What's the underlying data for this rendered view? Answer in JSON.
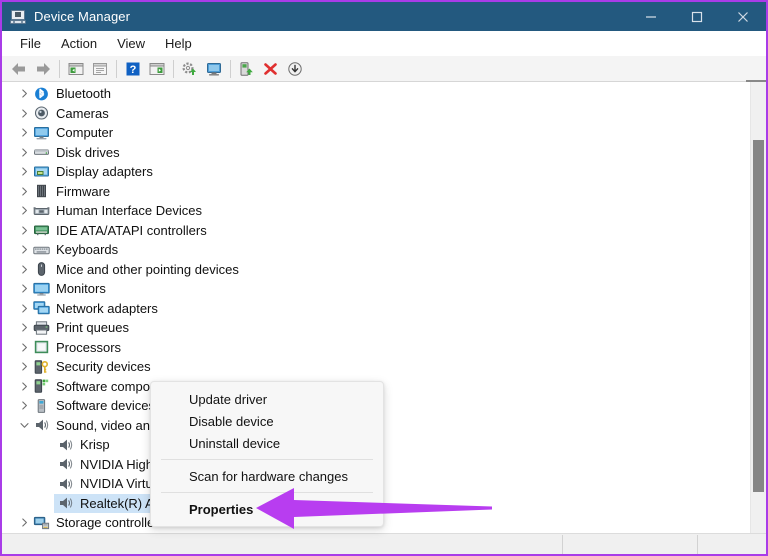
{
  "window": {
    "title": "Device Manager",
    "app_icon": "device-manager-icon",
    "border_color": "#a93ce8",
    "titlebar_color": "#23597f",
    "controls": [
      {
        "name": "minimize",
        "glyph": "minimize-icon"
      },
      {
        "name": "maximize",
        "glyph": "maximize-icon"
      },
      {
        "name": "close",
        "glyph": "close-icon"
      }
    ]
  },
  "menubar": {
    "items": [
      "File",
      "Action",
      "View",
      "Help"
    ]
  },
  "toolbar": {
    "buttons": [
      {
        "name": "back-icon",
        "label": "Back"
      },
      {
        "name": "forward-icon",
        "label": "Forward"
      },
      {
        "name": "show-hide-console-tree-icon",
        "label": "Show/Hide Console Tree"
      },
      {
        "name": "properties-icon",
        "label": "Properties"
      },
      {
        "name": "help-icon",
        "label": "Help"
      },
      {
        "name": "show-hide-action-pane-icon",
        "label": "Show/Hide Action Pane"
      },
      {
        "name": "update-driver-icon",
        "label": "Update driver"
      },
      {
        "name": "scan-for-hardware-changes-icon",
        "label": "Scan for hardware changes"
      },
      {
        "name": "enable-device-icon",
        "label": "Enable device"
      },
      {
        "name": "uninstall-device-icon",
        "label": "Uninstall device"
      },
      {
        "name": "disable-device-icon",
        "label": "Disable device"
      }
    ]
  },
  "tree": {
    "rows": [
      {
        "label": "Bluetooth",
        "icon": "bluetooth-icon",
        "expanded": false,
        "level": 0,
        "selected": false
      },
      {
        "label": "Cameras",
        "icon": "camera-icon",
        "expanded": false,
        "level": 0,
        "selected": false
      },
      {
        "label": "Computer",
        "icon": "computer-icon",
        "expanded": false,
        "level": 0,
        "selected": false
      },
      {
        "label": "Disk drives",
        "icon": "disk-drive-icon",
        "expanded": false,
        "level": 0,
        "selected": false
      },
      {
        "label": "Display adapters",
        "icon": "display-adapter-icon",
        "expanded": false,
        "level": 0,
        "selected": false
      },
      {
        "label": "Firmware",
        "icon": "firmware-icon",
        "expanded": false,
        "level": 0,
        "selected": false
      },
      {
        "label": "Human Interface Devices",
        "icon": "hid-icon",
        "expanded": false,
        "level": 0,
        "selected": false
      },
      {
        "label": "IDE ATA/ATAPI controllers",
        "icon": "ide-controller-icon",
        "expanded": false,
        "level": 0,
        "selected": false
      },
      {
        "label": "Keyboards",
        "icon": "keyboard-icon",
        "expanded": false,
        "level": 0,
        "selected": false
      },
      {
        "label": "Mice and other pointing devices",
        "icon": "mouse-icon",
        "expanded": false,
        "level": 0,
        "selected": false
      },
      {
        "label": "Monitors",
        "icon": "monitor-icon",
        "expanded": false,
        "level": 0,
        "selected": false
      },
      {
        "label": "Network adapters",
        "icon": "network-adapter-icon",
        "expanded": false,
        "level": 0,
        "selected": false
      },
      {
        "label": "Print queues",
        "icon": "printer-icon",
        "expanded": false,
        "level": 0,
        "selected": false
      },
      {
        "label": "Processors",
        "icon": "processor-icon",
        "expanded": false,
        "level": 0,
        "selected": false
      },
      {
        "label": "Security devices",
        "icon": "security-device-icon",
        "expanded": false,
        "level": 0,
        "selected": false
      },
      {
        "label": "Software components",
        "icon": "software-component-icon",
        "expanded": false,
        "level": 0,
        "selected": false
      },
      {
        "label": "Software devices",
        "icon": "software-device-icon",
        "expanded": false,
        "level": 0,
        "selected": false
      },
      {
        "label": "Sound, video and game controllers",
        "icon": "sound-icon",
        "expanded": true,
        "level": 0,
        "selected": false
      },
      {
        "label": "Krisp",
        "icon": "speaker-icon",
        "expanded": null,
        "level": 1,
        "selected": false
      },
      {
        "label": "NVIDIA High Definition Audio",
        "icon": "speaker-icon",
        "expanded": null,
        "level": 1,
        "selected": false
      },
      {
        "label": "NVIDIA Virtual Audio Device",
        "icon": "speaker-icon",
        "expanded": null,
        "level": 1,
        "selected": false
      },
      {
        "label": "Realtek(R) Audio",
        "icon": "speaker-icon",
        "expanded": null,
        "level": 1,
        "selected": true
      },
      {
        "label": "Storage controllers",
        "icon": "storage-controller-icon",
        "expanded": false,
        "level": 0,
        "selected": false
      }
    ],
    "selection_color": "#cde3f7"
  },
  "context_menu": {
    "items": [
      {
        "label": "Update driver",
        "bold": false,
        "separator_after": false
      },
      {
        "label": "Disable device",
        "bold": false,
        "separator_after": false
      },
      {
        "label": "Uninstall device",
        "bold": false,
        "separator_after": true
      },
      {
        "label": "Scan for hardware changes",
        "bold": false,
        "separator_after": true
      },
      {
        "label": "Properties",
        "bold": true,
        "separator_after": false
      }
    ]
  },
  "annotation": {
    "arrow_color": "#b83df0",
    "points_to": "Properties"
  },
  "statusbar": {
    "text": ""
  },
  "scrollbar": {
    "thumb_color": "#868686",
    "track_color": "#f0f0f0"
  }
}
